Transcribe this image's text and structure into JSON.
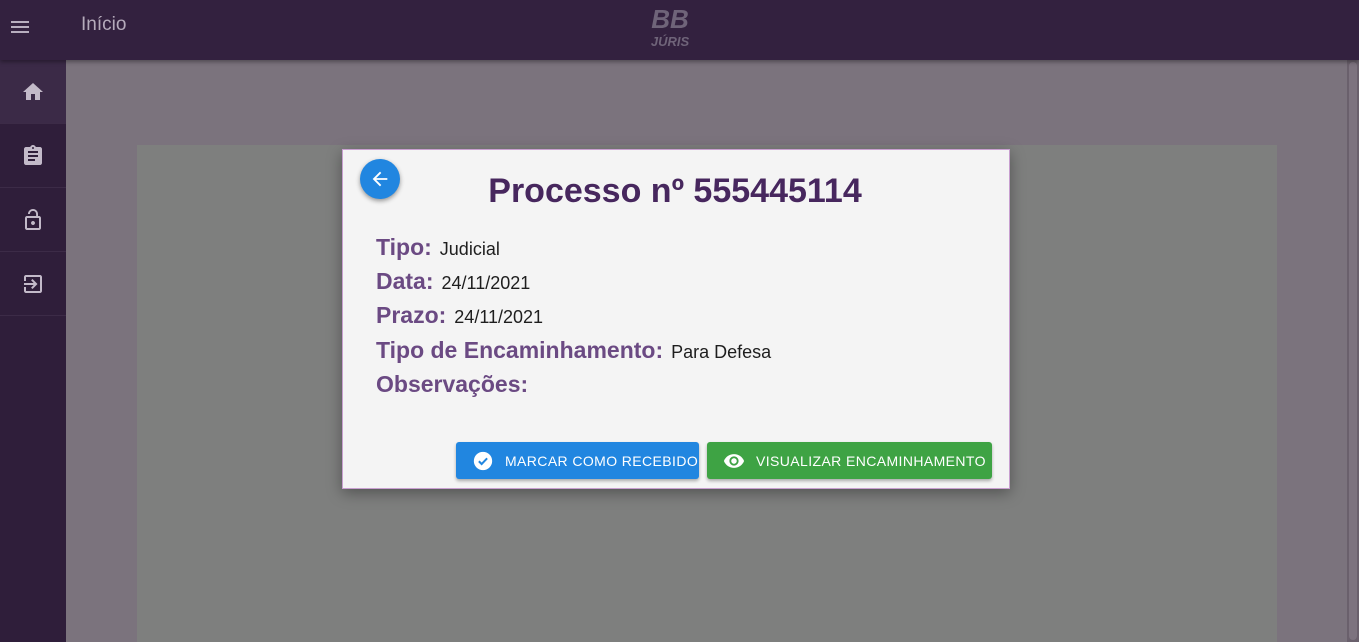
{
  "header": {
    "title": "Início",
    "logo": {
      "top": "BB",
      "bottom": "JÚRIS"
    }
  },
  "sidebar": {
    "items": [
      {
        "name": "home",
        "icon": "home-icon"
      },
      {
        "name": "clipboard",
        "icon": "clipboard-icon"
      },
      {
        "name": "lock",
        "icon": "lock-icon"
      },
      {
        "name": "logout",
        "icon": "logout-icon"
      }
    ]
  },
  "dialog": {
    "title": "Processo nº 555445114",
    "fields": [
      {
        "label": "Tipo:",
        "value": "Judicial"
      },
      {
        "label": "Data:",
        "value": "24/11/2021"
      },
      {
        "label": "Prazo:",
        "value": "24/11/2021"
      },
      {
        "label": "Tipo de Encaminhamento:",
        "value": "Para Defesa"
      },
      {
        "label": "Observações:",
        "value": ""
      }
    ],
    "buttons": {
      "mark_received": "MARCAR COMO RECEBIDO",
      "view_forwarding": "VISUALIZAR ENCAMINHAMENTO"
    }
  },
  "colors": {
    "topbar": "#33213f",
    "sidebar": "#2f1e3a",
    "accent_blue": "#2186e0",
    "accent_green": "#3ea344",
    "title_purple": "#47275e",
    "label_purple": "#6b4a83"
  }
}
